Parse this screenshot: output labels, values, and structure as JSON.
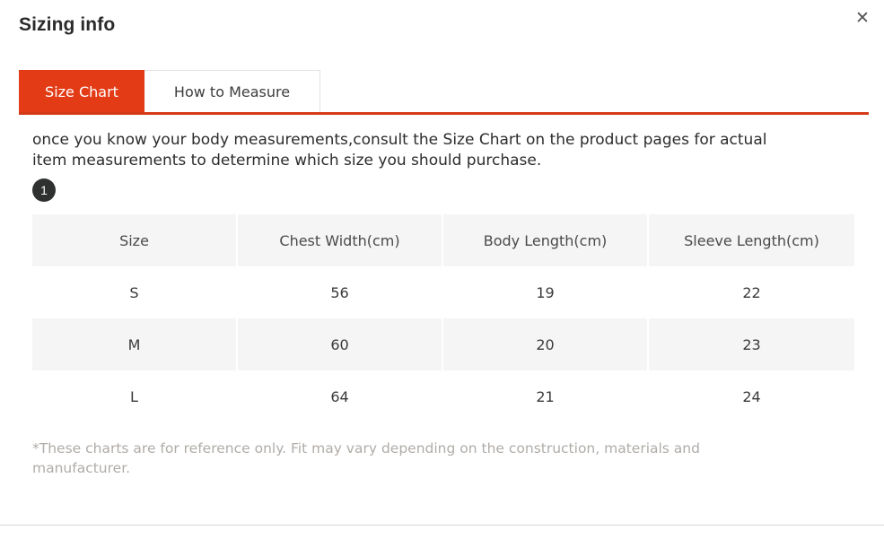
{
  "modal": {
    "title": "Sizing info",
    "close_icon": "close-icon",
    "close_glyph": "✕"
  },
  "tabs": [
    {
      "label": "Size Chart",
      "active": true
    },
    {
      "label": "How to Measure",
      "active": false
    }
  ],
  "content": {
    "intro": "once you know your body measurements,consult the Size Chart on the product pages for actual item measurements to determine which size you should purchase.",
    "step_badge": "1",
    "footnote": "*These charts are for reference only. Fit may vary depending on the construction, materials and manufacturer."
  },
  "table": {
    "headers": [
      "Size",
      "Chest Width(cm)",
      "Body Length(cm)",
      "Sleeve Length(cm)"
    ],
    "rows": [
      [
        "S",
        "56",
        "19",
        "22"
      ],
      [
        "M",
        "60",
        "20",
        "23"
      ],
      [
        "L",
        "64",
        "21",
        "24"
      ]
    ]
  },
  "bottom": {
    "ghost_left": " ",
    "ghost_right": " "
  },
  "colors": {
    "accent": "#e23b16",
    "accent_underline": "#d43a16",
    "header_row": "#f5f5f5",
    "badge": "#2f3130",
    "footnote_text": "#b0aca8"
  }
}
